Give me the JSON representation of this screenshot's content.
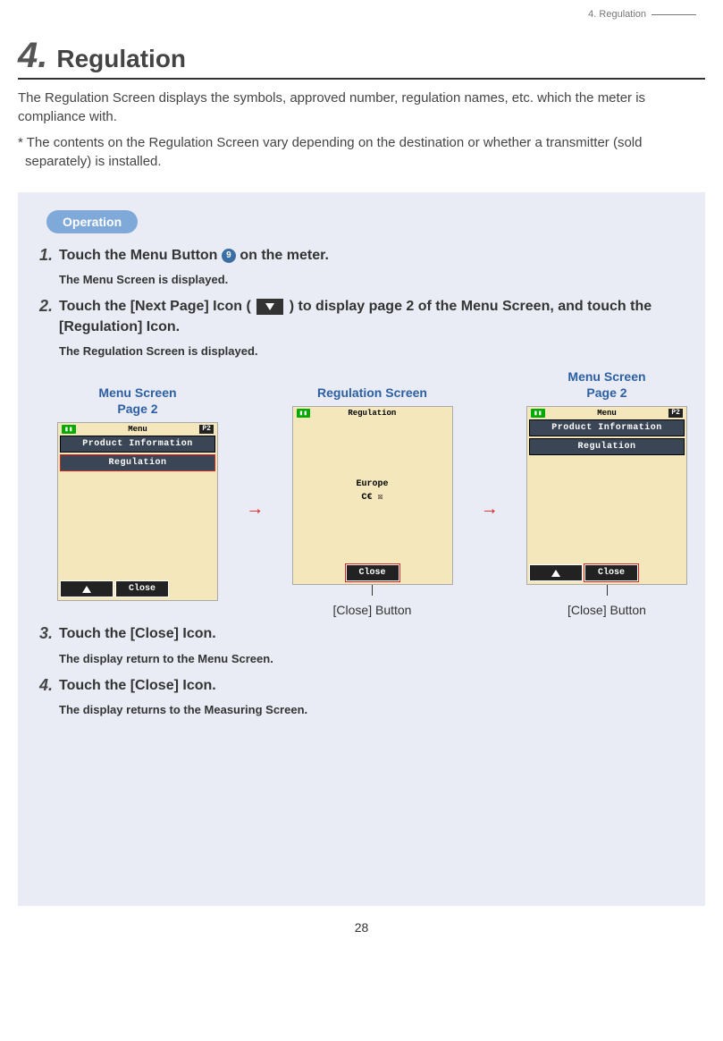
{
  "header": {
    "running_title": "4.  Regulation"
  },
  "section": {
    "number": "4.",
    "title": "Regulation"
  },
  "intro": "The Regulation Screen displays the symbols, approved number, regulation names, etc. which the meter is compliance with.",
  "note": "* The contents on the Regulation Screen vary depending on the destination or whether a transmitter (sold separately) is installed.",
  "operation_label": "Operation",
  "steps": {
    "s1": {
      "num": "1.",
      "title_a": "Touch the Menu Button ",
      "badge": "9",
      "title_b": " on the meter.",
      "result": "The Menu Screen is displayed."
    },
    "s2": {
      "num": "2.",
      "title_a": "Touch the [Next Page] Icon ( ",
      "title_b": " ) to display page 2 of the Menu Screen, and touch the [Regulation] Icon.",
      "result": "The Regulation Screen is displayed."
    },
    "s3": {
      "num": "3.",
      "title": "Touch the [Close] Icon.",
      "result": "The display return to the Menu Screen."
    },
    "s4": {
      "num": "4.",
      "title": "Touch the [Close] Icon.",
      "result": "The display returns to the Measuring Screen."
    }
  },
  "screenshots": {
    "menu_caption": "Menu Screen\nPage 2",
    "regulation_caption": "Regulation Screen",
    "close_caption": "[Close] Button",
    "menu": {
      "title": "Menu",
      "page_indicator": "P2",
      "item1": "Product Information",
      "item2": "Regulation",
      "close": "Close"
    },
    "regulation": {
      "title": "Regulation",
      "region": "Europe",
      "marks": "C€  ☒",
      "close": "Close"
    }
  },
  "page_number": "28"
}
